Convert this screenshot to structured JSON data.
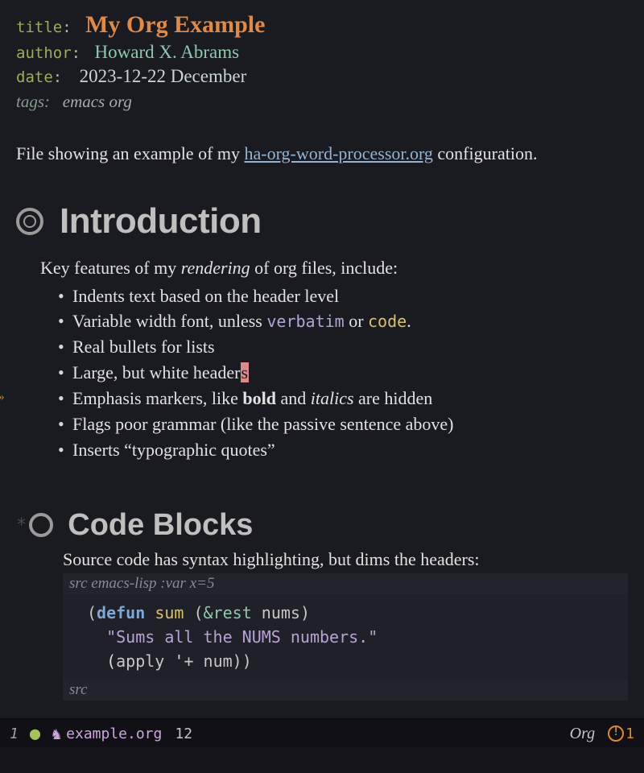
{
  "meta": {
    "title_key": "title",
    "title_val": "My Org Example",
    "author_key": "author",
    "author_val": "Howard X. Abrams",
    "date_key": "date",
    "date_val": "2023-12-22 December",
    "tags_key": "tags:",
    "tags_val": "emacs org"
  },
  "intro": {
    "before_link": "File showing an example of my ",
    "link": "ha-org-word-processor.org",
    "after_link": " configuration."
  },
  "h1": "Introduction",
  "lead_before": "Key features of my ",
  "lead_em": "rendering",
  "lead_after": " of org files, include:",
  "features": {
    "f1": "Indents text based on the header level",
    "f2a": "Variable width font, unless ",
    "f2_verb": "verbatim",
    "f2b": " or ",
    "f2_code": "code",
    "f2c": ".",
    "f3": "Real bullets for lists",
    "f4a": "Large, but white header",
    "f4_cursor": "s",
    "f5a": "Emphasis markers, like ",
    "f5_bold": "bold",
    "f5b": " and ",
    "f5_ital": "italics",
    "f5c": " are hidden",
    "f6": "Flags poor grammar (like the passive sentence above)",
    "f7": "Inserts “typographic quotes”"
  },
  "h2_star": "*",
  "h2": "Code Blocks",
  "src_intro": "Source code has syntax highlighting, but dims the headers:",
  "src_header_a": "src ",
  "src_header_b": "emacs-lisp :var x=5",
  "src_footer": "src",
  "code": {
    "l1_open": "(",
    "l1_defun": "defun",
    "l1_sp1": " ",
    "l1_fn": "sum",
    "l1_sp2": " ",
    "l1_po": "(",
    "l1_amp": "&rest",
    "l1_sp3": " ",
    "l1_arg": "nums",
    "l1_pc": ")",
    "l2_str": "  \"Sums all the NUMS numbers.\"",
    "l3_a": "  (",
    "l3_apply": "apply",
    "l3_b": " '",
    "l3_plus": "+",
    "l3_c": " ",
    "l3_num": "num",
    "l3_close": "))"
  },
  "modeline": {
    "win": "1",
    "unicorn": "♞",
    "file": "example.org",
    "line": "12",
    "mode": "Org",
    "warn_count": "1"
  }
}
